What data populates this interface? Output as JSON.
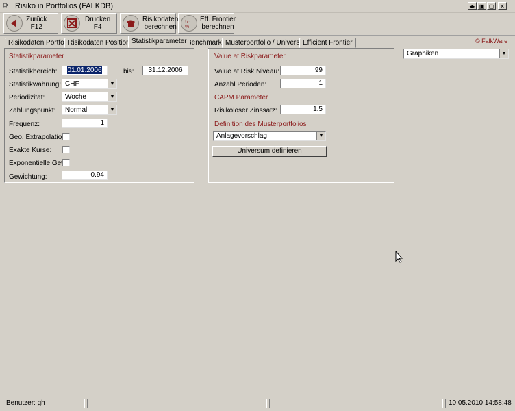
{
  "window": {
    "title": "Risiko in Portfolios    (FALKDB)",
    "controls": [
      "◂▸",
      "▣",
      "▢",
      "✕"
    ]
  },
  "toolbar": [
    {
      "line1": "Zurück",
      "line2": "F12",
      "color": "#8b1a1a"
    },
    {
      "line1": "Drucken",
      "line2": "F4",
      "color": "#8b1a1a"
    },
    {
      "line1": "Risikodaten",
      "line2": "berechnen",
      "color": "#8b1a1a"
    },
    {
      "line1": "Eff. Frontier",
      "line2": "berechnen",
      "color": "#8b1a1a"
    }
  ],
  "tabs": [
    {
      "label": "Risikodaten Portfolio"
    },
    {
      "label": "Risikodaten Positionen"
    },
    {
      "label": "Statistikparameter"
    },
    {
      "label": "Benchmarks"
    },
    {
      "label": "Musterportfolio / Universum"
    },
    {
      "label": "Efficient Frontier"
    }
  ],
  "brand": "© FalkWare",
  "stat": {
    "heading": "Statistikparameter",
    "bereich_label": "Statistikbereich:",
    "bereich_from": "01.01.2006",
    "bis_label": "bis:",
    "bereich_to": "31.12.2006",
    "waehrung_label": "Statistikwährung:",
    "waehrung_value": "CHF",
    "periodizitaet_label": "Periodizität:",
    "periodizitaet_value": "Woche",
    "zahlungspunkt_label": "Zahlungspunkt:",
    "zahlungspunkt_value": "Normal",
    "frequenz_label": "Frequenz:",
    "frequenz_value": "1",
    "geo_label": "Geo. Extrapolation:",
    "exakte_label": "Exakte Kurse:",
    "expo_label": "Exponentielle Gew.:",
    "gewichtung_label": "Gewichtung:",
    "gewichtung_value": "0.94"
  },
  "var": {
    "heading": "Value at Riskparameter",
    "niveau_label": "Value at Risk Niveau:",
    "niveau_value": "99",
    "perioden_label": "Anzahl Perioden:",
    "perioden_value": "1",
    "capm_heading": "CAPM Parameter",
    "zins_label": "Risikoloser Zinssatz:",
    "zins_value": "1.5",
    "muster_heading": "Definition des Musterportfolios",
    "muster_value": "Anlagevorschlag",
    "universum_button": "Universum definieren"
  },
  "graphiken": {
    "value": "Graphiken"
  },
  "status": {
    "user": "Benutzer: gh",
    "datetime": "10.05.2010 14:58:48"
  }
}
